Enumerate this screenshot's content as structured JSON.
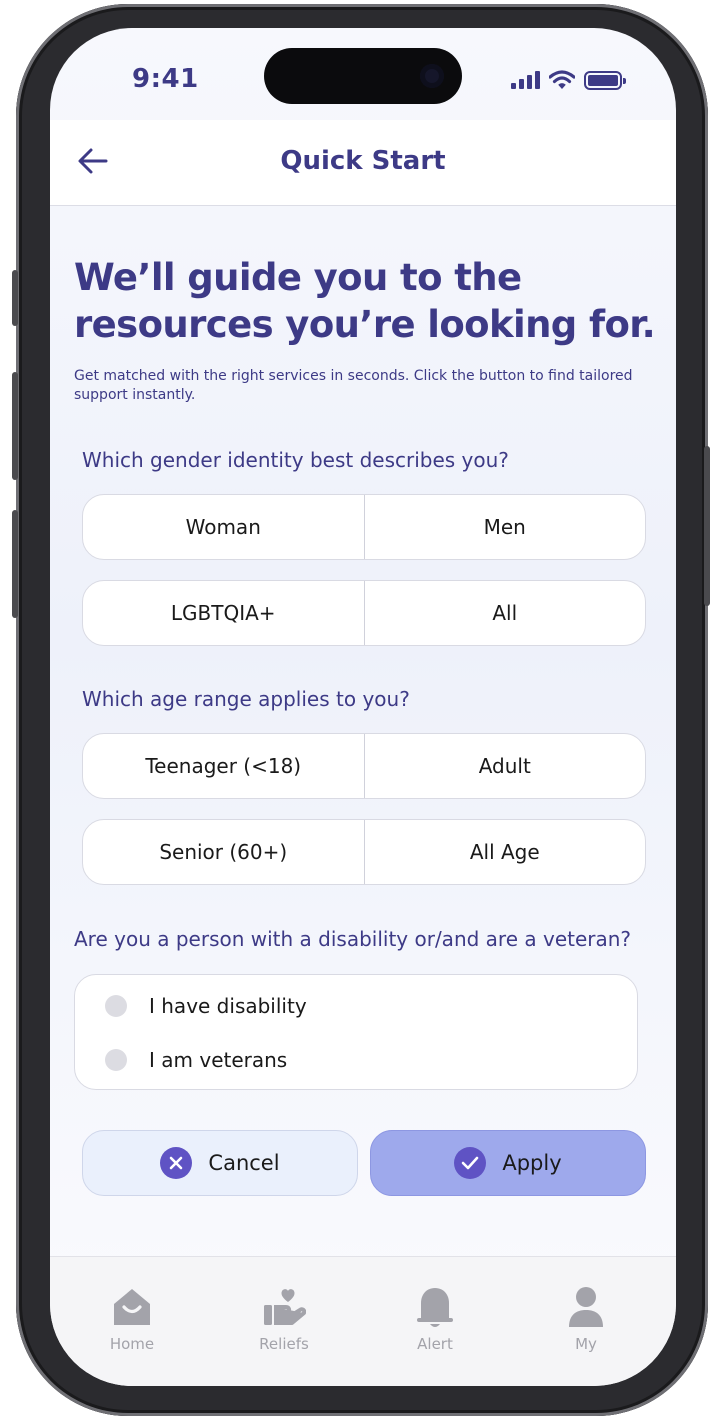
{
  "status_bar": {
    "time": "9:41"
  },
  "header": {
    "title": "Quick Start"
  },
  "intro": {
    "headline": "We’ll guide you to the resources you’re looking for.",
    "subtext": "Get matched with the right services in seconds. Click the button to find tailored support instantly."
  },
  "gender": {
    "question": "Which gender identity best describes you?",
    "options": [
      "Woman",
      "Men",
      "LGBTQIA+",
      "All"
    ]
  },
  "age": {
    "question": "Which age range applies to you?",
    "options": [
      "Teenager (<18)",
      "Adult",
      "Senior (60+)",
      "All Age"
    ]
  },
  "status": {
    "question": "Are you a person with a disability or/and are a veteran?",
    "options": [
      "I have disability",
      "I am veterans"
    ]
  },
  "actions": {
    "cancel_label": "Cancel",
    "apply_label": "Apply"
  },
  "tabbar": {
    "items": [
      "Home",
      "Reliefs",
      "Alert",
      "My"
    ]
  },
  "colors": {
    "primary": "#3d3a86",
    "accent": "#5f53c4",
    "apply_bg": "#9ea9ec",
    "cancel_bg": "#eaf0fc",
    "tab_icon": "#a3a3aa"
  }
}
